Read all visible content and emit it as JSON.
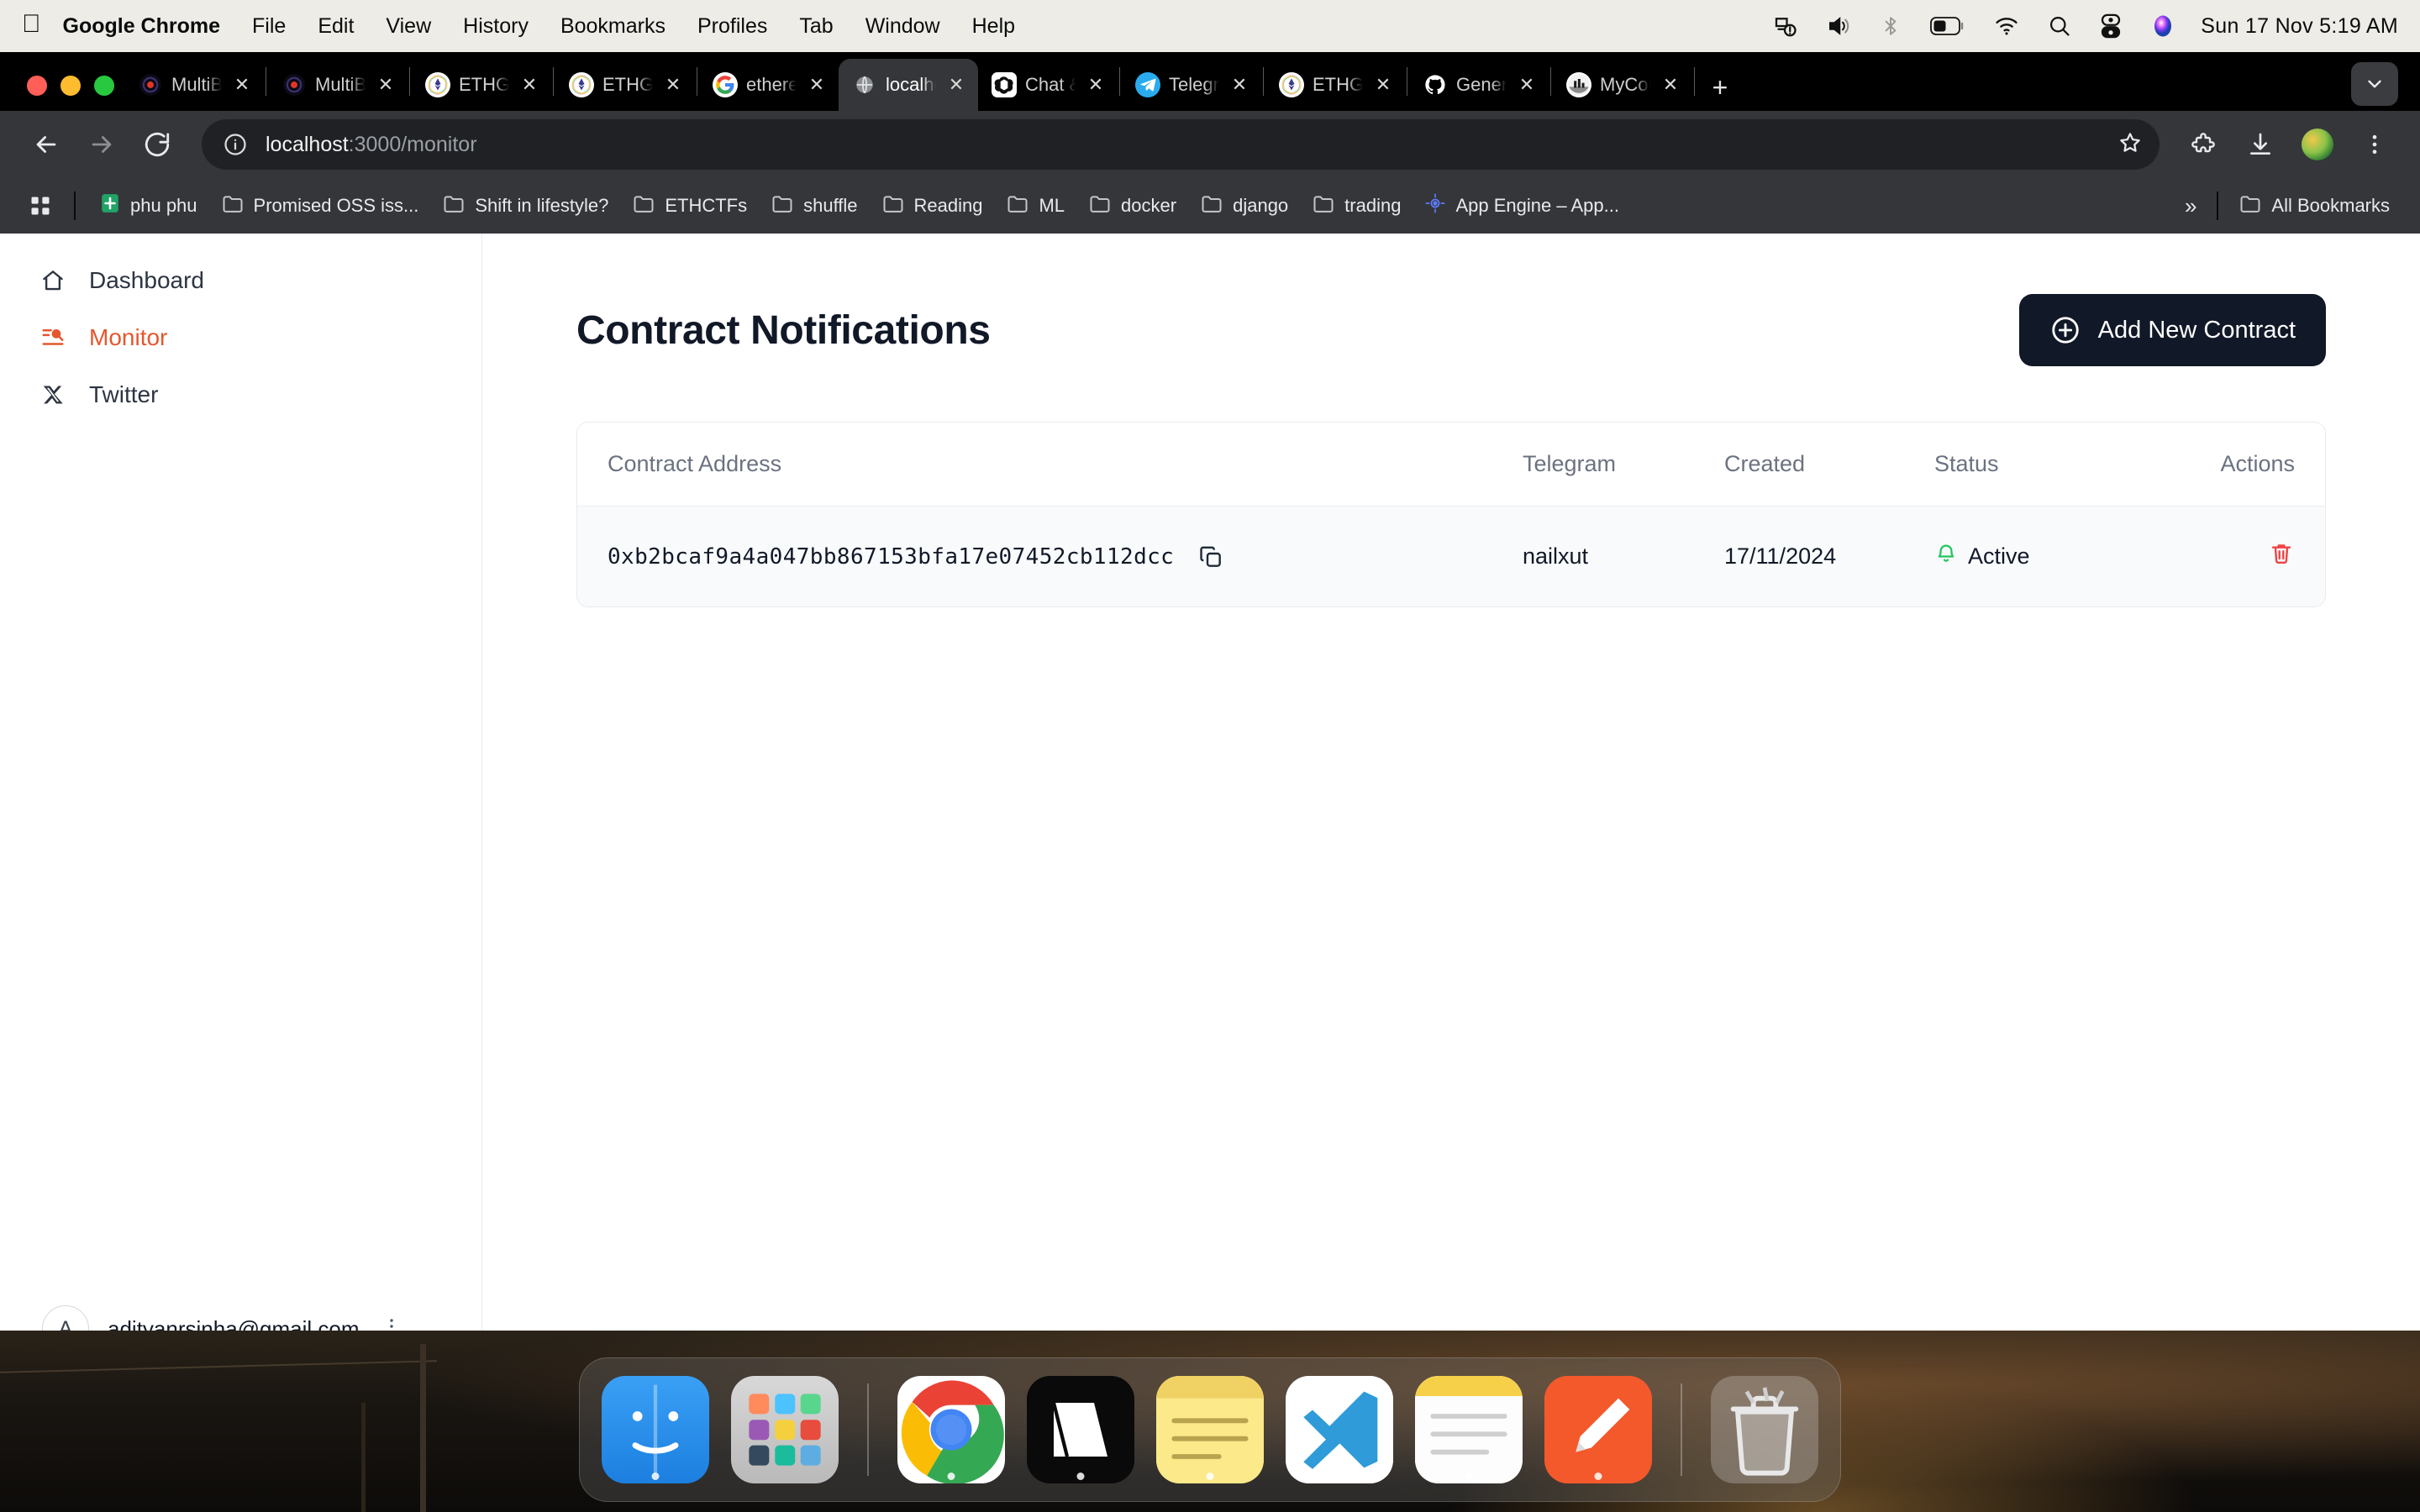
{
  "menubar": {
    "apple_icon": "apple-logo",
    "items": [
      {
        "label": "Google Chrome",
        "bold": true
      },
      {
        "label": "File",
        "bold": false
      },
      {
        "label": "Edit",
        "bold": false
      },
      {
        "label": "View",
        "bold": false
      },
      {
        "label": "History",
        "bold": false
      },
      {
        "label": "Bookmarks",
        "bold": false
      },
      {
        "label": "Profiles",
        "bold": false
      },
      {
        "label": "Tab",
        "bold": false
      },
      {
        "label": "Window",
        "bold": false
      },
      {
        "label": "Help",
        "bold": false
      }
    ],
    "status_icons": [
      "screen-mirror-icon",
      "volume-icon",
      "bluetooth-icon",
      "battery-icon",
      "wifi-icon",
      "spotlight-search-icon",
      "control-center-icon",
      "siri-icon"
    ],
    "clock": "Sun 17 Nov  5:19 AM"
  },
  "browser": {
    "tabs": [
      {
        "title": "MultiBa",
        "favicon": "multibaas-icon",
        "active": false
      },
      {
        "title": "MultiBa",
        "favicon": "multibaas-icon",
        "active": false
      },
      {
        "title": "ETHGlo",
        "favicon": "ethglobal-icon",
        "active": false
      },
      {
        "title": "ETHGlo",
        "favicon": "ethglobal-icon",
        "active": false
      },
      {
        "title": "ethereu",
        "favicon": "google-icon",
        "active": false
      },
      {
        "title": "localho",
        "favicon": "globe-icon",
        "active": true
      },
      {
        "title": "Chat &",
        "favicon": "chatgpt-icon",
        "active": false
      },
      {
        "title": "Telegra",
        "favicon": "telegram-icon",
        "active": false
      },
      {
        "title": "ETHGlo",
        "favicon": "ethglobal-icon",
        "active": false
      },
      {
        "title": "Genera",
        "favicon": "github-icon",
        "active": false
      },
      {
        "title": "MyCon",
        "favicon": "mycontract-icon",
        "active": false
      }
    ],
    "new_tab_label": "+",
    "tab_list_chevron": "chevron-down-icon",
    "nav": {
      "back": "back-arrow-icon",
      "forward": "forward-arrow-icon",
      "reload": "reload-icon"
    },
    "omnibox": {
      "site_info_icon": "info-circle-icon",
      "url_host": "localhost",
      "url_path": ":3000/monitor",
      "bookmark_icon": "star-icon"
    },
    "toolbar_icons": [
      "extensions-icon",
      "downloads-icon",
      "profile-avatar",
      "three-dot-menu-icon"
    ],
    "bookmarks": {
      "apps_icon": "apps-grid-icon",
      "items": [
        {
          "label": "phu phu",
          "icon": "sheets-icon"
        },
        {
          "label": "Promised OSS iss...",
          "icon": "folder-icon"
        },
        {
          "label": "Shift in lifestyle?",
          "icon": "folder-icon"
        },
        {
          "label": "ETHCTFs",
          "icon": "folder-icon"
        },
        {
          "label": "shuffle",
          "icon": "folder-icon"
        },
        {
          "label": "Reading",
          "icon": "folder-icon"
        },
        {
          "label": "ML",
          "icon": "folder-icon"
        },
        {
          "label": "docker",
          "icon": "folder-icon"
        },
        {
          "label": "django",
          "icon": "folder-icon"
        },
        {
          "label": "trading",
          "icon": "folder-icon"
        },
        {
          "label": "App Engine – App...",
          "icon": "appengine-icon"
        }
      ],
      "overflow_label": "»",
      "all_bookmarks_label": "All Bookmarks",
      "all_bookmarks_icon": "folder-icon"
    }
  },
  "app": {
    "sidebar": {
      "items": [
        {
          "label": "Dashboard",
          "icon": "home-icon",
          "active": false
        },
        {
          "label": "Monitor",
          "icon": "monitor-search-icon",
          "active": true
        },
        {
          "label": "Twitter",
          "icon": "x-twitter-icon",
          "active": false
        }
      ],
      "user": {
        "avatar_initial": "A",
        "email": "adityanrsinha@gmail.com",
        "menu_icon": "kebab-menu-icon"
      },
      "active_color": "#e4572e"
    },
    "main": {
      "title": "Contract Notifications",
      "add_button": {
        "label": "Add New Contract",
        "icon": "plus-circle-icon"
      },
      "table": {
        "columns": [
          "Contract Address",
          "Telegram",
          "Created",
          "Status",
          "Actions"
        ],
        "rows": [
          {
            "address": "0xb2bcaf9a4a047bb867153bfa17e07452cb112dcc",
            "copy_icon": "copy-icon",
            "telegram": "nailxut",
            "created": "17/11/2024",
            "status": "Active",
            "status_icon": "bell-icon",
            "status_color": "#22c55e",
            "delete_icon": "trash-icon",
            "delete_color": "#ef4444"
          }
        ]
      }
    }
  },
  "dock": {
    "items": [
      {
        "name": "finder",
        "running": true
      },
      {
        "name": "launchpad",
        "running": false
      },
      {
        "name": "google-chrome",
        "running": true
      },
      {
        "name": "terminal",
        "running": true
      },
      {
        "name": "notes",
        "running": true
      },
      {
        "name": "visual-studio-code",
        "running": true
      },
      {
        "name": "stickies",
        "running": true
      },
      {
        "name": "preview",
        "running": true
      },
      {
        "name": "trash",
        "running": false
      }
    ]
  }
}
